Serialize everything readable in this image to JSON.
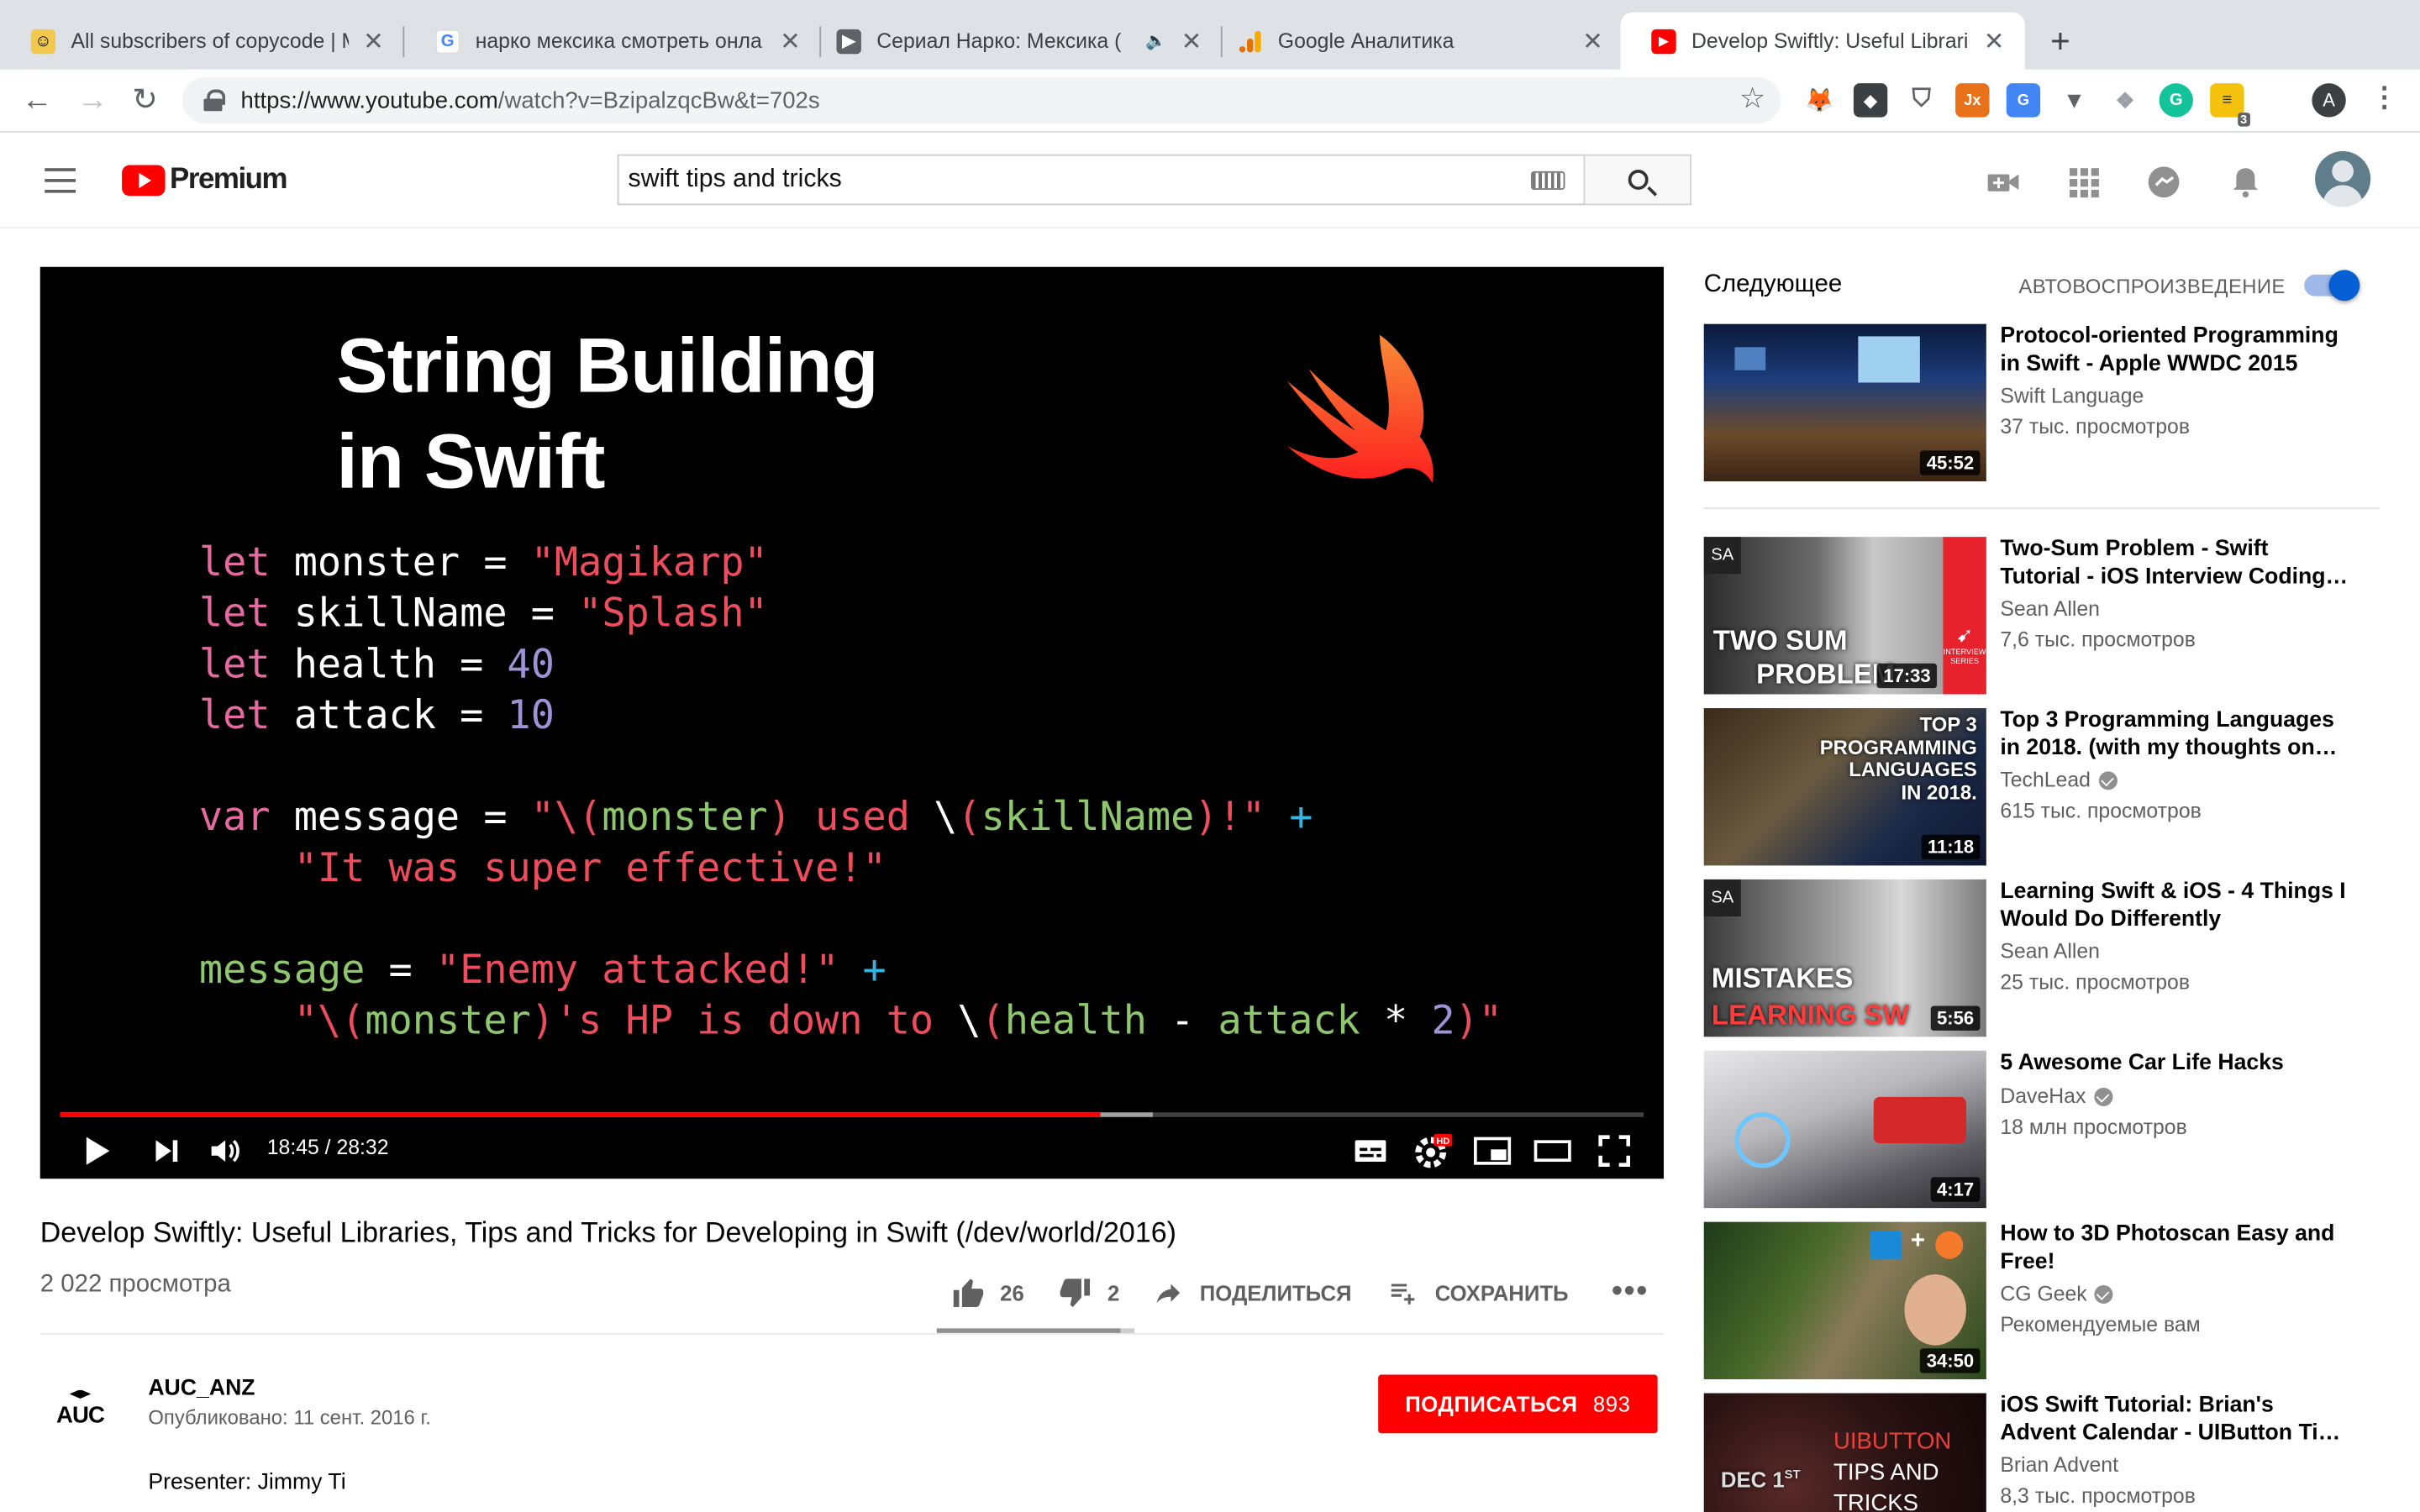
{
  "browser": {
    "tabs": [
      {
        "label": "All subscribers of copycode | M",
        "favicon": "mailchimp-icon",
        "color": "#f2c94c"
      },
      {
        "label": "нарко мексика смотреть онла",
        "favicon": "google-icon",
        "color": "#4285f4"
      },
      {
        "label": "Сериал Нарко: Мексика (",
        "favicon": "play-icon",
        "color": "#5f6368"
      },
      {
        "label": "Google Аналитика",
        "favicon": "analytics-icon",
        "color": "#f9ab00"
      },
      {
        "label": "Develop Swiftly: Useful Librarie",
        "favicon": "youtube-icon",
        "color": "#ff0000"
      }
    ],
    "new_tab": "+",
    "url_host": "https://www.youtube.com",
    "url_path": "/watch?v=BzipalzqcBw&t=702s",
    "ext_badge": "3",
    "profile_initial": "A"
  },
  "youtube": {
    "logo_text": "Premium",
    "search_value": "swift tips and tricks"
  },
  "player": {
    "slide_title_1": "String Building",
    "slide_title_2": "in Swift",
    "time": "18:45 / 28:32",
    "progress_fraction": 0.657,
    "buffer_fraction": 0.69,
    "code": {
      "l1_kw": "let",
      "l1_name": " monster = ",
      "l1_str": "\"Magikarp\"",
      "l2_kw": "let",
      "l2_name": " skillName = ",
      "l2_str": "\"Splash\"",
      "l3_kw": "let",
      "l3_name": " health = ",
      "l3_num": "40",
      "l4_kw": "let",
      "l4_name": " attack = ",
      "l4_num": "10",
      "l5_kw": "var",
      "l5_name": " message = ",
      "l5_a": "\"\\",
      "l5_b": "(",
      "l5_c": "monster",
      "l5_d": ")",
      "l5_e": " used ",
      "l5_f": "\\",
      "l5_g": "(",
      "l5_h": "skillName",
      "l5_i": ")",
      "l5_j": "!\"",
      "l5_plus": " +",
      "l6": "    \"It was super effective!\"",
      "l7_name": "message",
      "l7_eq": " = ",
      "l7_str": "\"Enemy attacked!\"",
      "l7_plus": " +",
      "l8_a": "    \"\\",
      "l8_b": "(",
      "l8_c": "monster",
      "l8_d": ")",
      "l8_e": "'s HP is down to ",
      "l8_f": "\\",
      "l8_g": "(",
      "l8_h": "health",
      "l8_i": " - ",
      "l8_j": "attack",
      "l8_k": " * ",
      "l8_l": "2",
      "l8_m": ")",
      "l8_n": "\""
    }
  },
  "video": {
    "title": "Develop Swiftly: Useful Libraries, Tips and Tricks for Developing in Swift (/dev/world/2016)",
    "views": "2 022 просмотра",
    "likes": "26",
    "dislikes": "2",
    "share_label": "ПОДЕЛИТЬСЯ",
    "save_label": "СОХРАНИТЬ",
    "channel": "AUC_ANZ",
    "channel_logo_text": "AUC",
    "published": "Опубликовано: 11 сент. 2016 г.",
    "subscribe_label": "ПОДПИСАТЬСЯ",
    "subscriber_count": "893",
    "description": "Presenter: Jimmy Ti"
  },
  "sidebar": {
    "up_next": "Следующее",
    "autoplay": "АВТОВОСПРОИЗВЕДЕНИЕ",
    "autoplay_on": true,
    "items": [
      {
        "title": "Protocol-oriented Programming in Swift - Apple WWDC 2015",
        "channel": "Swift Language",
        "views": "37 тыс. просмотров",
        "duration": "45:52",
        "verified": false
      },
      {
        "title": "Two-Sum Problem - Swift Tutorial - iOS Interview Coding…",
        "channel": "Sean Allen",
        "views": "7,6 тыс. просмотров",
        "duration": "17:33",
        "verified": false,
        "badge": "SA",
        "overlay": "TWO SUM PROBLEM",
        "overlay_1": "TWO SUM",
        "overlay_2": "PROBLEM",
        "side_label": "INTERVIEW SERIES"
      },
      {
        "title": "Top 3 Programming Languages in 2018. (with my thoughts on…",
        "channel": "TechLead",
        "views": "615 тыс. просмотров",
        "duration": "11:18",
        "verified": true,
        "overlay_1": "TOP 3",
        "overlay_2": "PROGRAMMING",
        "overlay_3": "LANGUAGES",
        "overlay_4": "IN 2018."
      },
      {
        "title": "Learning Swift & iOS - 4 Things I Would Do Differently",
        "channel": "Sean Allen",
        "views": "25 тыс. просмотров",
        "duration": "5:56",
        "verified": false,
        "badge": "SA",
        "overlay_1": "MISTAKES",
        "overlay_2": "LEARNING SW"
      },
      {
        "title": "5 Awesome Car Life Hacks",
        "channel": "DaveHax",
        "views": "18 млн просмотров",
        "duration": "4:17",
        "verified": true
      },
      {
        "title": "How to 3D Photoscan Easy and Free!",
        "channel": "CG Geek",
        "views": "Рекомендуемые вам",
        "duration": "34:50",
        "verified": true
      },
      {
        "title": "iOS Swift Tutorial: Brian's Advent Calendar - UIButton Ti…",
        "channel": "Brian Advent",
        "views": "8,3 тыс. просмотров",
        "duration": "",
        "verified": false,
        "overlay_1": "UIBUTTON",
        "overlay_2": "TIPS AND",
        "overlay_3": "TRICKS",
        "date": "DEC 1",
        "date_sup": "ST"
      }
    ]
  },
  "colors": {
    "accent": "#ff0000",
    "link_blue": "#065fd4"
  }
}
